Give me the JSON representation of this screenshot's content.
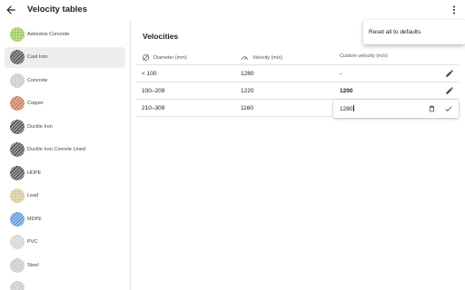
{
  "appbar": {
    "title": "Velocity tables"
  },
  "sidebar": {
    "items": [
      {
        "label": "Asbestos Concrete",
        "color": "#a6cf6a",
        "pattern": "dots",
        "selected": false
      },
      {
        "label": "Cast Iron",
        "color": "#555555",
        "pattern": "hatch",
        "selected": true
      },
      {
        "label": "Concrete",
        "color": "#cfcfcf",
        "pattern": "dots",
        "selected": false
      },
      {
        "label": "Copper",
        "color": "#c97a55",
        "pattern": "hatch",
        "selected": false
      },
      {
        "label": "Ductile Iron",
        "color": "#555555",
        "pattern": "hatch",
        "selected": false
      },
      {
        "label": "Ductile Iron Conrete Lined",
        "color": "#555555",
        "pattern": "hatch",
        "selected": false
      },
      {
        "label": "HDPE",
        "color": "#555555",
        "pattern": "hatch",
        "selected": false
      },
      {
        "label": "Lead",
        "color": "#d8cfa4",
        "pattern": "dots",
        "selected": false
      },
      {
        "label": "MDPE",
        "color": "#5b9bd9",
        "pattern": "hatch",
        "selected": false
      },
      {
        "label": "PVC",
        "color": "#d2d2d2",
        "pattern": "hatch",
        "selected": false
      },
      {
        "label": "Steel",
        "color": "#c9c9c9",
        "pattern": "hatch",
        "selected": false
      },
      {
        "label": "",
        "color": "#c9c9c9",
        "pattern": "hatch",
        "selected": false
      }
    ]
  },
  "main": {
    "title": "Velocities",
    "columns": {
      "diameter": "Diameter (mm)",
      "velocity": "Velocity (m/s)",
      "custom": "Custom velocity (m/s)"
    },
    "rows": [
      {
        "diameter": "< 100",
        "velocity": "1280",
        "custom": "-",
        "custom_bold": false,
        "editing": false
      },
      {
        "diameter": "100–209",
        "velocity": "1220",
        "custom": "1200",
        "custom_bold": true,
        "editing": false
      },
      {
        "diameter": "210–309",
        "velocity": "1160",
        "custom": "",
        "custom_bold": false,
        "editing": true
      }
    ],
    "editor": {
      "value": "1280"
    }
  },
  "menu": {
    "reset_label": "Reset all to defaults"
  }
}
